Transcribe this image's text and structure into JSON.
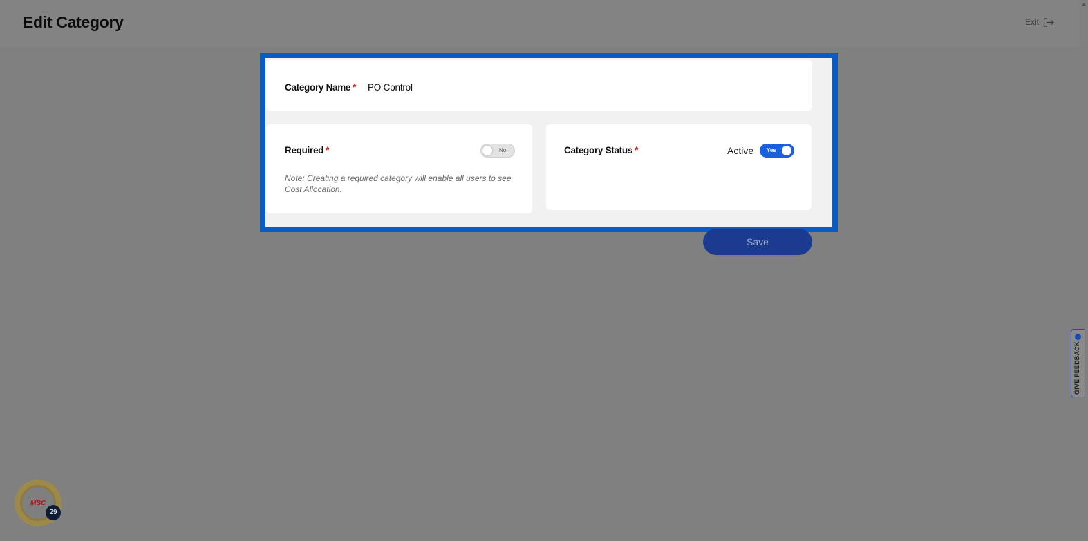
{
  "header": {
    "title": "Edit Category",
    "exit_label": "Exit"
  },
  "form": {
    "category_name": {
      "label": "Category Name",
      "required_marker": "*",
      "value": "PO Control"
    },
    "required": {
      "label": "Required",
      "required_marker": "*",
      "toggle_text": "No",
      "toggle_on": false,
      "note": "Note: Creating a required category will enable all users to see Cost Allocation."
    },
    "category_status": {
      "label": "Category Status",
      "required_marker": "*",
      "status_text": "Active",
      "toggle_text": "Yes",
      "toggle_on": true
    }
  },
  "actions": {
    "save_label": "Save"
  },
  "feedback": {
    "label": "GIVE FEEDBACK"
  },
  "assistant_badge": {
    "logo_text": "MSC",
    "count": "29"
  },
  "colors": {
    "highlight_border": "#0a5bc4",
    "toggle_on": "#1a5fe0",
    "required_star": "#d81b1b",
    "save_button": "#1a3b8f"
  }
}
